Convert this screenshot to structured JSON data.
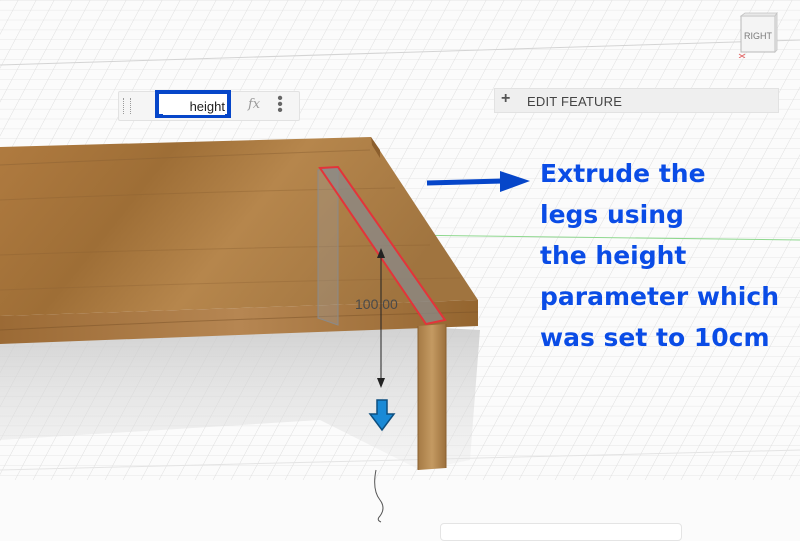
{
  "toolbar": {
    "parameter_value": "height",
    "fx_label": "fx",
    "more_icon": "kebab-vertical-icon"
  },
  "edit_feature": {
    "label": "EDIT FEATURE",
    "icon": "plus-icon"
  },
  "viewcube": {
    "face_label": "RIGHT"
  },
  "dimension": {
    "value_text": "100.00"
  },
  "annotation": {
    "text": "Extrude the\nlegs using\nthe height\nparameter which\nwas set to 10cm",
    "color": "#0a4ce6"
  },
  "colors": {
    "highlight_box": "#0646c9",
    "sketch_outline": "#e3343a",
    "manipulator_arrow": "#1a8ad6",
    "wood": "#a5773d"
  }
}
